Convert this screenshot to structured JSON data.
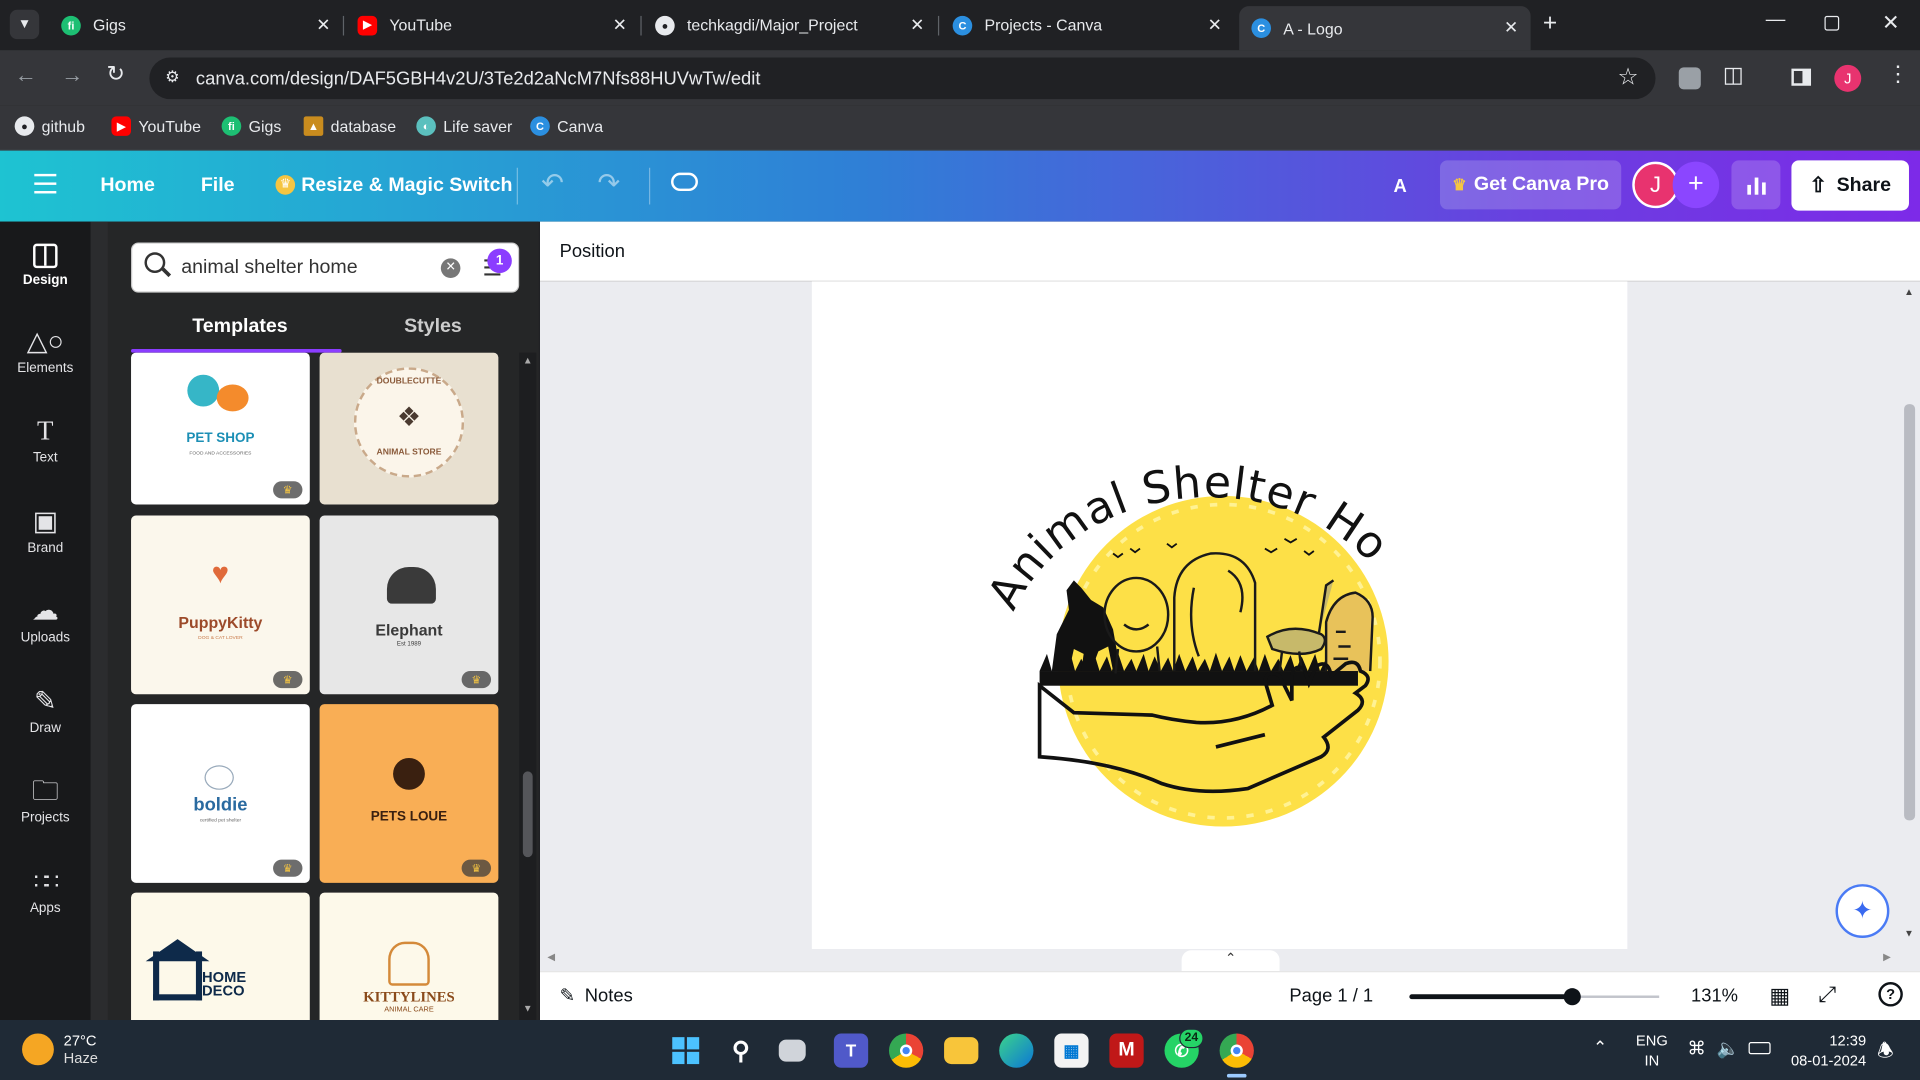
{
  "browser": {
    "tabs": [
      {
        "title": "Gigs"
      },
      {
        "title": "YouTube"
      },
      {
        "title": "techkagdi/Major_Project"
      },
      {
        "title": "Projects - Canva"
      },
      {
        "title": "A - Logo"
      }
    ],
    "url": "canva.com/design/DAF5GBH4v2U/3Te2d2aNcM7Nfs88HUVwTw/edit",
    "avatar": "J",
    "bookmarks": [
      "github",
      "YouTube",
      "Gigs",
      "database",
      "Life saver",
      "Canva"
    ]
  },
  "header": {
    "home": "Home",
    "file": "File",
    "resize": "Resize & Magic Switch",
    "doc_title": "A",
    "get_pro": "Get Canva Pro",
    "avatar": "J",
    "share": "Share"
  },
  "rail": [
    "Design",
    "Elements",
    "Text",
    "Brand",
    "Uploads",
    "Draw",
    "Projects",
    "Apps"
  ],
  "panel": {
    "search_value": "animal shelter home",
    "filter_count": "1",
    "tabs": [
      "Templates",
      "Styles"
    ],
    "templates": [
      {
        "title": "PET SHOP",
        "subtitle": "FOOD AND ACCESSORIES",
        "premium": true,
        "bg": "#ffffff",
        "color": "#1c8fb5"
      },
      {
        "title": "DOUBLECUTTE",
        "subtitle": "ANIMAL STORE",
        "premium": false,
        "bg": "#e8e0d0",
        "color": "#8a5a3a"
      },
      {
        "title": "PuppyKitty",
        "subtitle": "DOG & CAT LOVER",
        "premium": true,
        "bg": "#fbf7ec",
        "color": "#9c4a2a"
      },
      {
        "title": "Elephant",
        "subtitle": "Est 1989",
        "premium": true,
        "bg": "#e7e7e7",
        "color": "#3a3a3a"
      },
      {
        "title": "boldie",
        "subtitle": "certified pet shelter",
        "premium": true,
        "bg": "#ffffff",
        "color": "#2a6aa0"
      },
      {
        "title": "PETS LOUE",
        "subtitle": "",
        "premium": true,
        "bg": "#f9ae55",
        "color": "#3a2010"
      },
      {
        "title": "HOME DECO",
        "subtitle": "",
        "premium": false,
        "bg": "#fdf9ea",
        "color": "#0e2a4a"
      },
      {
        "title": "KITTYLINES",
        "subtitle": "ANIMAL CARE",
        "premium": false,
        "bg": "#fdf9ea",
        "color": "#8a4a1a"
      }
    ]
  },
  "toolbar": {
    "position": "Position"
  },
  "design": {
    "curved_title": "Animal Shelter Home",
    "sun_color": "#fde047"
  },
  "footer": {
    "notes": "Notes",
    "page": "Page 1 / 1",
    "zoom": "131%",
    "zoom_level_percent": 131
  },
  "taskbar": {
    "temp": "27°C",
    "weather": "Haze",
    "lang1": "ENG",
    "lang2": "IN",
    "time": "12:39",
    "date": "08-01-2024",
    "whatsapp_badge": "24"
  }
}
